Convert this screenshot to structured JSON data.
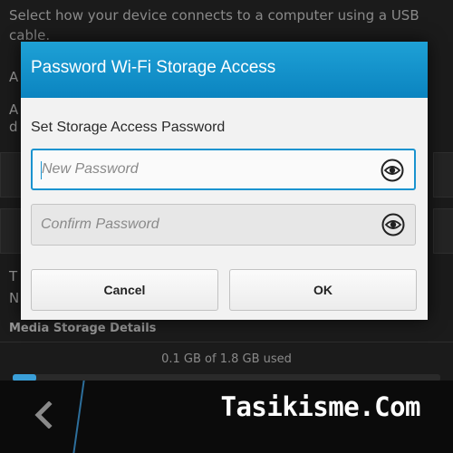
{
  "background": {
    "description": "Select how your device connects to a computer using a USB cable.",
    "fragments": [
      "A",
      "A",
      "d",
      "T",
      "N"
    ],
    "media_storage_title": "Media Storage Details",
    "storage_used": "0.1 GB of 1.8 GB used",
    "storage_fill_fraction": 0.055
  },
  "dialog": {
    "title": "Password Wi-Fi Storage Access",
    "subtitle": "Set Storage Access Password",
    "new_password": {
      "placeholder": "New Password",
      "value": ""
    },
    "confirm_password": {
      "placeholder": "Confirm Password",
      "value": ""
    },
    "cancel_label": "Cancel",
    "ok_label": "OK"
  },
  "bottom_bar": {
    "back_icon": "chevron-left-icon"
  },
  "watermark": "Tasikisme.Com",
  "colors": {
    "accent": "#1a93cf",
    "header_top": "#1ea1d6",
    "header_bottom": "#0b84c0",
    "storage_bar": "#3a9fd8"
  }
}
